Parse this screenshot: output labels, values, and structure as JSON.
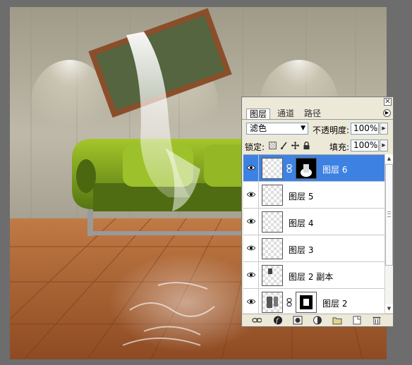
{
  "panel": {
    "close_glyph": "✕",
    "tabs": [
      {
        "label": "图层",
        "active": true
      },
      {
        "label": "通道",
        "active": false
      },
      {
        "label": "路径",
        "active": false
      }
    ],
    "menu_glyph": "▶",
    "blend_mode": "滤色",
    "opacity_label": "不透明度:",
    "opacity_value": "100%",
    "lock_label": "锁定:",
    "fill_label": "填充:",
    "fill_value": "100%",
    "layers": [
      {
        "name": "图层 6",
        "visible": true,
        "selected": true,
        "has_mask": true
      },
      {
        "name": "图层 5",
        "visible": true,
        "selected": false,
        "has_mask": false
      },
      {
        "name": "图层 4",
        "visible": true,
        "selected": false,
        "has_mask": false
      },
      {
        "name": "图层 3",
        "visible": true,
        "selected": false,
        "has_mask": false
      },
      {
        "name": "图层 2 副本",
        "visible": true,
        "selected": false,
        "has_mask": false
      },
      {
        "name": "图层 2",
        "visible": true,
        "selected": false,
        "has_mask": true
      }
    ],
    "bottom_icons": [
      "link-layers-icon",
      "layer-style-icon",
      "add-mask-icon",
      "adjustment-layer-icon",
      "new-group-icon",
      "new-layer-icon",
      "trash-icon"
    ],
    "colors": {
      "selected": "#3d82e3",
      "panel_bg": "#ece9d8"
    }
  }
}
